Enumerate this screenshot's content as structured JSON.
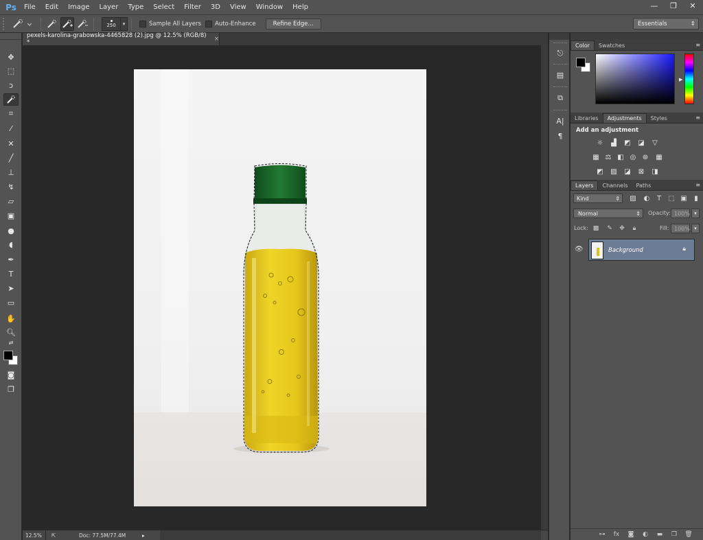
{
  "app": {
    "logo": "Ps",
    "menu": [
      "File",
      "Edit",
      "Image",
      "Layer",
      "Type",
      "Select",
      "Filter",
      "3D",
      "View",
      "Window",
      "Help"
    ],
    "window_controls": [
      "—",
      "❐",
      "✕"
    ]
  },
  "options": {
    "brush_size": "250",
    "sample_all_layers": "Sample All Layers",
    "auto_enhance": "Auto-Enhance",
    "refine_edge": "Refine Edge...",
    "workspace": "Essentials"
  },
  "document": {
    "tab_title": "pexels-karolina-grabowska-4465828 (2).jpg @ 12.5% (RGB/8) *",
    "tab_close": "×"
  },
  "status": {
    "zoom": "12.5%",
    "doc_size": "Doc: 77.5M/77.4M"
  },
  "panels": {
    "color_tabs": [
      "Color",
      "Swatches"
    ],
    "adjust_tabs": [
      "Libraries",
      "Adjustments",
      "Styles"
    ],
    "adjust_title": "Add an adjustment",
    "layers_tabs": [
      "Layers",
      "Channels",
      "Paths"
    ],
    "kind": "Kind",
    "blend_mode": "Normal",
    "opacity_label": "Opacity:",
    "opacity_value": "100%",
    "lock_label": "Lock:",
    "fill_label": "Fill:",
    "fill_value": "100%",
    "layer_name": "Background"
  },
  "colors": {
    "ui_dark": "#282828",
    "panel": "#535353",
    "selected_layer": "#6c7c94",
    "oil": "#e3c51a",
    "cap": "#1f6b2a"
  },
  "icons": {
    "toolbar": [
      "move-icon",
      "marquee-icon",
      "lasso-icon",
      "quick-selection-icon",
      "crop-icon",
      "eyedropper-icon",
      "healing-icon",
      "brush-icon",
      "stamp-icon",
      "history-brush-icon",
      "eraser-icon",
      "gradient-icon",
      "blur-icon",
      "dodge-icon",
      "pen-icon",
      "type-icon",
      "path-selection-icon",
      "rectangle-icon",
      "hand-icon",
      "zoom-icon"
    ]
  }
}
